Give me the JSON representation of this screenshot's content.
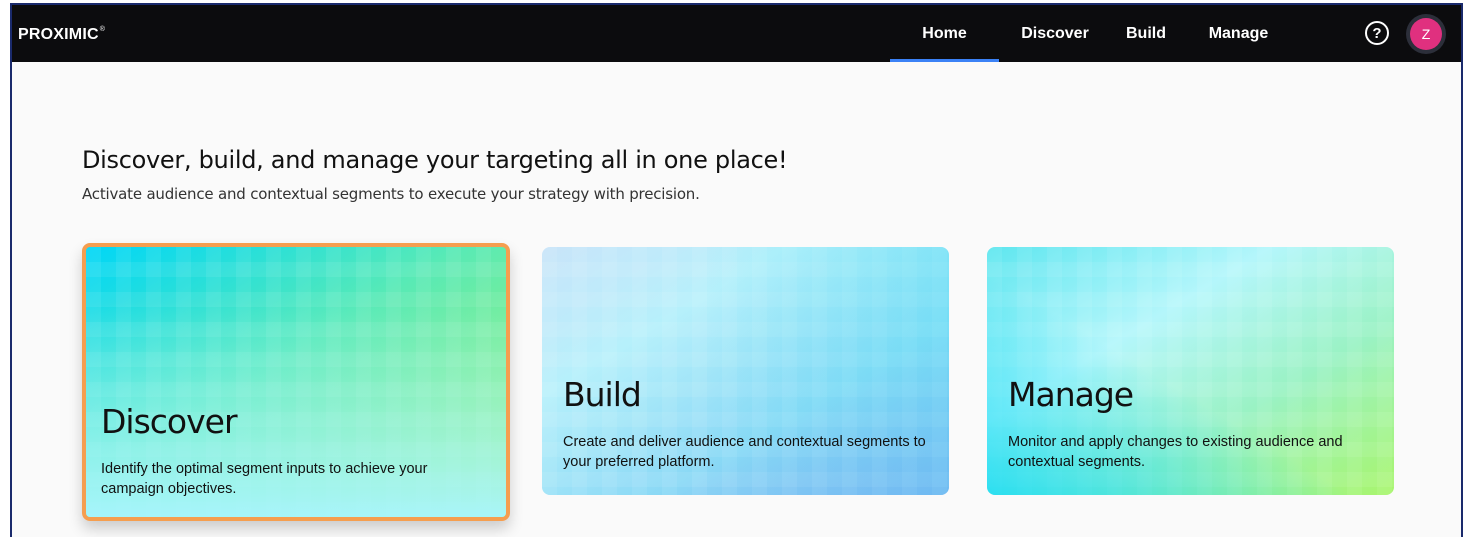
{
  "topbar": {
    "logo": "PROXIMIC",
    "logo_mark": "®",
    "nav": [
      {
        "label": "Home",
        "active": true
      },
      {
        "label": "Discover",
        "active": false
      },
      {
        "label": "Build",
        "active": false
      },
      {
        "label": "Manage",
        "active": false
      }
    ],
    "help_icon": "?",
    "avatar_initial": "Z"
  },
  "main": {
    "headline": "Discover, build, and manage your targeting all in one place!",
    "subline": "Activate audience and contextual segments to execute your strategy with precision.",
    "cards": [
      {
        "title": "Discover",
        "description": "Identify the optimal segment inputs to achieve your campaign objectives.",
        "selected": true
      },
      {
        "title": "Build",
        "description": "Create and deliver audience and contextual segments to your preferred platform.",
        "selected": false
      },
      {
        "title": "Manage",
        "description": "Monitor and apply changes to existing audience and contextual segments.",
        "selected": false
      }
    ]
  },
  "colors": {
    "topbar_bg": "#0c0c0e",
    "active_tab_indicator": "#3b82f6",
    "selected_card_border": "#f59e4f",
    "avatar_bg": "#e0307f"
  }
}
